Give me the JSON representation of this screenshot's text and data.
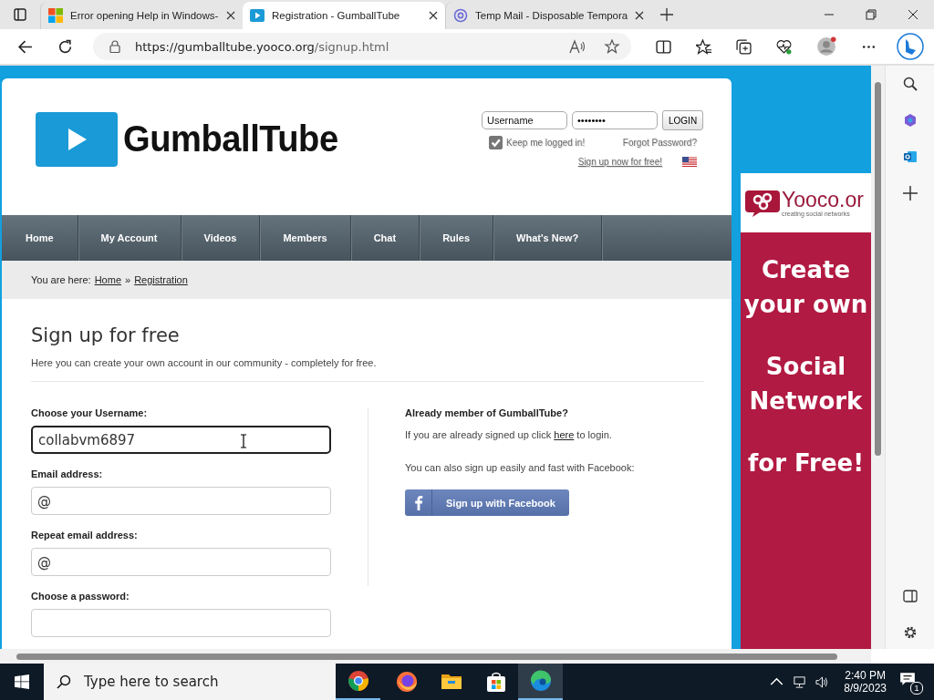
{
  "browser": {
    "tabs": [
      {
        "title": "Error opening Help in Windows-",
        "kind": "windows",
        "selected": false
      },
      {
        "title": "Registration - GumballTube",
        "kind": "play",
        "selected": true
      },
      {
        "title": "Temp Mail - Disposable Tempora",
        "kind": "at",
        "selected": false
      }
    ],
    "address": {
      "host": "https://gumballtube.yooco.org",
      "path": "/signup.html"
    }
  },
  "site": {
    "logo": "GumballTube",
    "login": {
      "username_placeholder": "Username",
      "password": "••••••••",
      "button": "LOGIN",
      "keep_logged_in": {
        "label": "Keep me logged in!",
        "checked": true
      },
      "forgot": "Forgot Password?",
      "signup_link": "Sign up now for free!"
    },
    "nav": [
      "Home",
      "My Account",
      "Videos",
      "Members",
      "Chat",
      "Rules",
      "What's New?"
    ],
    "breadcrumb": {
      "prefix": "You are here:",
      "items": [
        "Home",
        "Registration"
      ],
      "separator": "»"
    },
    "heading": "Sign up for free",
    "intro": "Here you can create your own account in our community - completely for free.",
    "form": [
      {
        "label": "Choose your Username:",
        "value": "collabvm6897",
        "focused": true
      },
      {
        "label": "Email address:",
        "value": "@",
        "focused": false
      },
      {
        "label": "Repeat email address:",
        "value": "@",
        "focused": false
      },
      {
        "label": "Choose a password:",
        "focused": false
      }
    ],
    "member": {
      "title": "Already member of GumballTube?",
      "login_before": "If you are already signed up click",
      "login_link": "here",
      "login_after": "to login.",
      "facebook_text": "You can also sign up easily and fast with Facebook:",
      "facebook_button": "Sign up with Facebook"
    },
    "ad": {
      "brand": "Yooco.or",
      "tagline": "creating social networks",
      "lines": [
        "Create your own",
        "Social Network",
        "for Free!"
      ]
    }
  },
  "taskbar": {
    "search_placeholder": "Type here to search",
    "apps": [
      {
        "kind": "chrome",
        "running": true,
        "selected": false
      },
      {
        "kind": "firefox",
        "running": false,
        "selected": false
      },
      {
        "kind": "explorer",
        "running": false,
        "selected": false
      },
      {
        "kind": "store",
        "running": false,
        "selected": false
      },
      {
        "kind": "edge",
        "running": true,
        "selected": true
      }
    ],
    "time": "2:40 PM",
    "date": "8/9/2023",
    "notifications": "1"
  }
}
